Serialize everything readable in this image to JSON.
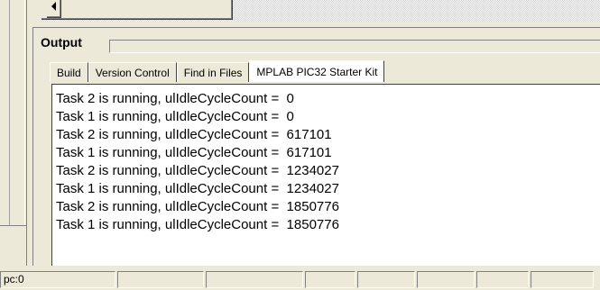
{
  "output": {
    "title": "Output",
    "tabs": [
      {
        "label": "Build"
      },
      {
        "label": "Version Control"
      },
      {
        "label": "Find in Files"
      },
      {
        "label": "MPLAB PIC32 Starter Kit"
      }
    ],
    "active_tab": "MPLAB PIC32 Starter Kit",
    "lines": [
      "Task 2 is running, ulIdleCycleCount =  0",
      "Task 1 is running, ulIdleCycleCount =  0",
      "Task 2 is running, ulIdleCycleCount =  617101",
      "Task 1 is running, ulIdleCycleCount =  617101",
      "Task 2 is running, ulIdleCycleCount =  1234027",
      "Task 1 is running, ulIdleCycleCount =  1234027",
      "Task 2 is running, ulIdleCycleCount =  1850776",
      "Task 1 is running, ulIdleCycleCount =  1850776"
    ]
  },
  "status_bar": {
    "cells": [
      "pc:0",
      "",
      "",
      "",
      "",
      "",
      "",
      ""
    ]
  },
  "icons": {
    "scroll_left": "left-arrow-icon"
  }
}
